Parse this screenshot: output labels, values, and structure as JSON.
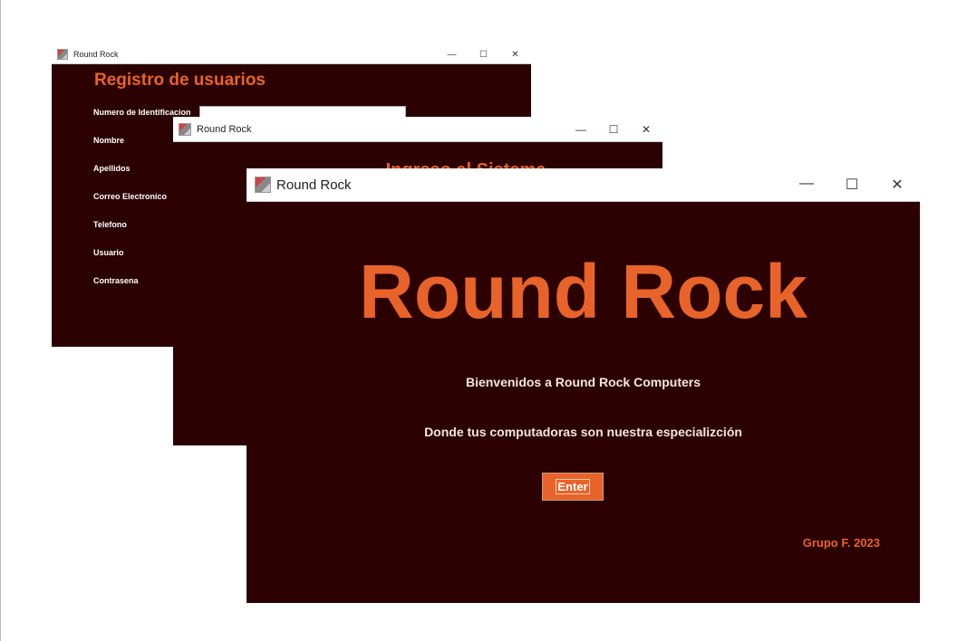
{
  "colors": {
    "background": "#2b0101",
    "accent": "#e8632a"
  },
  "registro": {
    "window_title": "Round Rock",
    "heading": "Registro de usuarios",
    "fields": [
      "Numero de Identificacion",
      "Nombre",
      "Apellidos",
      "Correo Electronico",
      "Telefono",
      "Usuario",
      "Contrasena"
    ],
    "id_value": ""
  },
  "login": {
    "window_title": "Round Rock",
    "heading": "Ingreso al Sistema"
  },
  "welcome": {
    "window_title": "Round Rock",
    "title": "Round Rock",
    "line1": "Bienvenidos a Round Rock Computers",
    "line2": "Donde tus computadoras son nuestra especializción",
    "enter_label": "Enter",
    "footer": "Grupo F. 2023"
  },
  "controls": {
    "minimize": "—",
    "maximize": "☐",
    "close": "✕"
  }
}
